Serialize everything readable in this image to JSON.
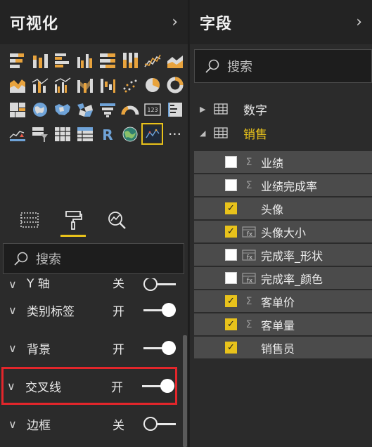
{
  "visualizations": {
    "title": "可视化",
    "collapse_icon": "chevron-right-icon",
    "gallery_icons": [
      "stacked-bar-icon",
      "stacked-column-icon",
      "clustered-bar-icon",
      "clustered-column-icon",
      "100-stacked-bar-icon",
      "100-stacked-column-icon",
      "line-chart-icon",
      "area-chart-icon",
      "stacked-area-icon",
      "line-column-icon",
      "line-clustered-column-icon",
      "ribbon-chart-icon",
      "waterfall-icon",
      "scatter-icon",
      "pie-chart-icon",
      "donut-chart-icon",
      "treemap-icon",
      "map-icon",
      "filled-map-icon",
      "shape-map-icon",
      "funnel-icon",
      "gauge-icon",
      "card-icon",
      "multirow-card-icon",
      "kpi-icon",
      "slicer-icon",
      "table-icon",
      "matrix-icon",
      "r-visual-icon",
      "globe-icon",
      "custom-visual-icon"
    ],
    "more_label": "···",
    "tabs": [
      "fields-well-icon",
      "paint-roller-icon",
      "analytics-icon"
    ],
    "search_placeholder": "搜索",
    "format_sections": [
      {
        "name": "Y 轴",
        "state": "关",
        "on": false,
        "partial": true
      },
      {
        "name": "类别标签",
        "state": "开",
        "on": true
      },
      {
        "name": "背景",
        "state": "开",
        "on": true
      },
      {
        "name": "交叉线",
        "state": "开",
        "on": true,
        "highlight": true
      },
      {
        "name": "边框",
        "state": "关",
        "on": false
      }
    ]
  },
  "fields": {
    "title": "字段",
    "collapse_icon": "chevron-right-icon",
    "search_placeholder": "搜索",
    "tables": [
      {
        "name": "数字",
        "expanded": false
      },
      {
        "name": "销售",
        "expanded": true
      }
    ],
    "items": [
      {
        "name": "业绩",
        "checked": false,
        "type": "Σ"
      },
      {
        "name": "业绩完成率",
        "checked": false,
        "type": "Σ"
      },
      {
        "name": "头像",
        "checked": true,
        "type": ""
      },
      {
        "name": "头像大小",
        "checked": true,
        "type": "measure"
      },
      {
        "name": "完成率_形状",
        "checked": false,
        "type": "measure"
      },
      {
        "name": "完成率_颜色",
        "checked": false,
        "type": "measure"
      },
      {
        "name": "客单价",
        "checked": true,
        "type": "Σ"
      },
      {
        "name": "客单量",
        "checked": true,
        "type": "Σ"
      },
      {
        "name": "销售员",
        "checked": true,
        "type": ""
      }
    ]
  }
}
